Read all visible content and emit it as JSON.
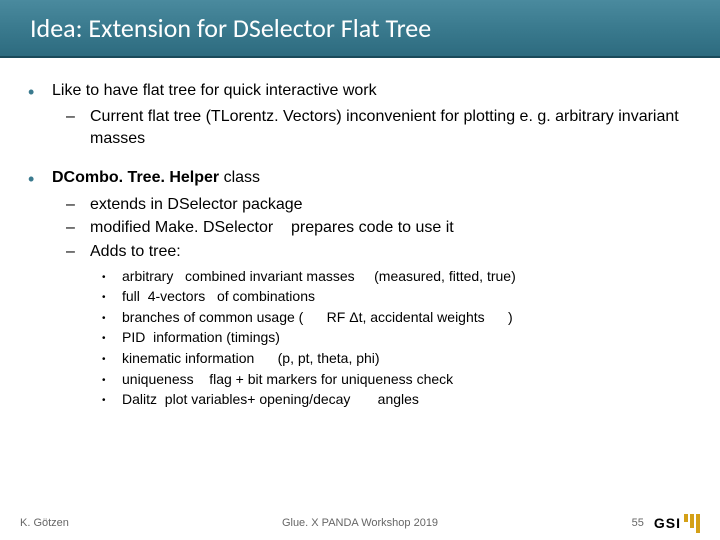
{
  "title": "Idea: Extension for DSelector Flat Tree",
  "b1": {
    "main": "Like to have flat tree for quick interactive work",
    "s1": "Current flat tree (TLorentz. Vectors) inconvenient for plotting e. g. arbitrary invariant masses"
  },
  "b2": {
    "main_prefix": "DCombo. Tree. Helper",
    "main_suffix": " class",
    "s1": "extends in DSelector package",
    "s2a": "modified Make. DSelector",
    "s2b": "prepares code to use it",
    "s3": "Adds to tree:",
    "ss1a": "arbitrary",
    "ss1b": "combined invariant masses",
    "ss1c": "(measured, fitted, true)",
    "ss2a": "full",
    "ss2b": "4-vectors",
    "ss2c": "of combinations",
    "ss3a": "branches of common usage (",
    "ss3b": "RF Δt, accidental weights",
    "ss3c": ")",
    "ss4a": "PID",
    "ss4b": "information (timings)",
    "ss5a": "kinematic information",
    "ss5b": "(p, pt, theta, phi)",
    "ss6a": "uniqueness",
    "ss6b": "flag + bit markers for uniqueness check",
    "ss7a": "Dalitz",
    "ss7b": "plot variables+ opening/decay",
    "ss7c": "angles"
  },
  "footer": {
    "author": "K. Götzen",
    "event": "Glue. X PANDA Workshop 2019",
    "page": "55",
    "logo_text": "GSI"
  }
}
